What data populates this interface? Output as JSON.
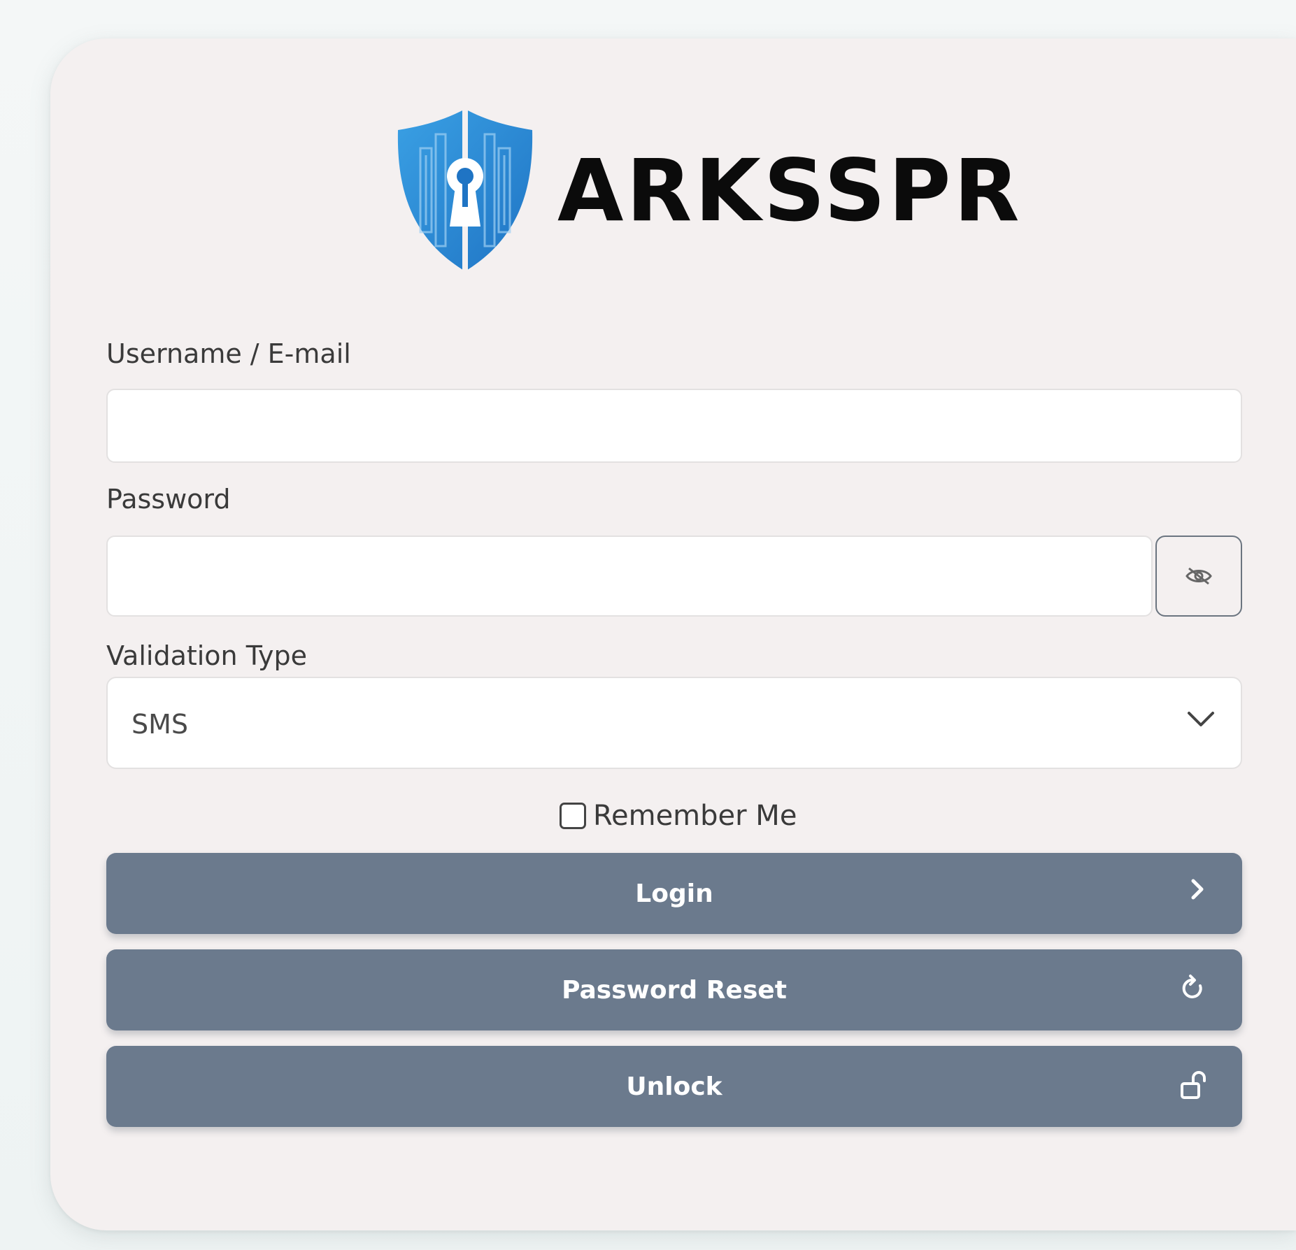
{
  "brand": {
    "name": "ARKSSPR",
    "logo_icon": "shield-keyhole-icon",
    "accent_color": "#2f8fd6"
  },
  "form": {
    "username_label": "Username / E-mail",
    "username_value": "",
    "password_label": "Password",
    "password_value": "",
    "toggle_icon": "eye-slash-icon",
    "validation_label": "Validation Type",
    "validation_value": "SMS",
    "remember_label": "Remember Me",
    "remember_checked": false
  },
  "buttons": {
    "login": {
      "label": "Login",
      "icon": "chevron-right-icon"
    },
    "reset": {
      "label": "Password Reset",
      "icon": "refresh-icon"
    },
    "unlock": {
      "label": "Unlock",
      "icon": "unlock-icon"
    }
  },
  "colors": {
    "button_bg": "#6b7a8d",
    "card_bg": "#f4f0f0"
  }
}
